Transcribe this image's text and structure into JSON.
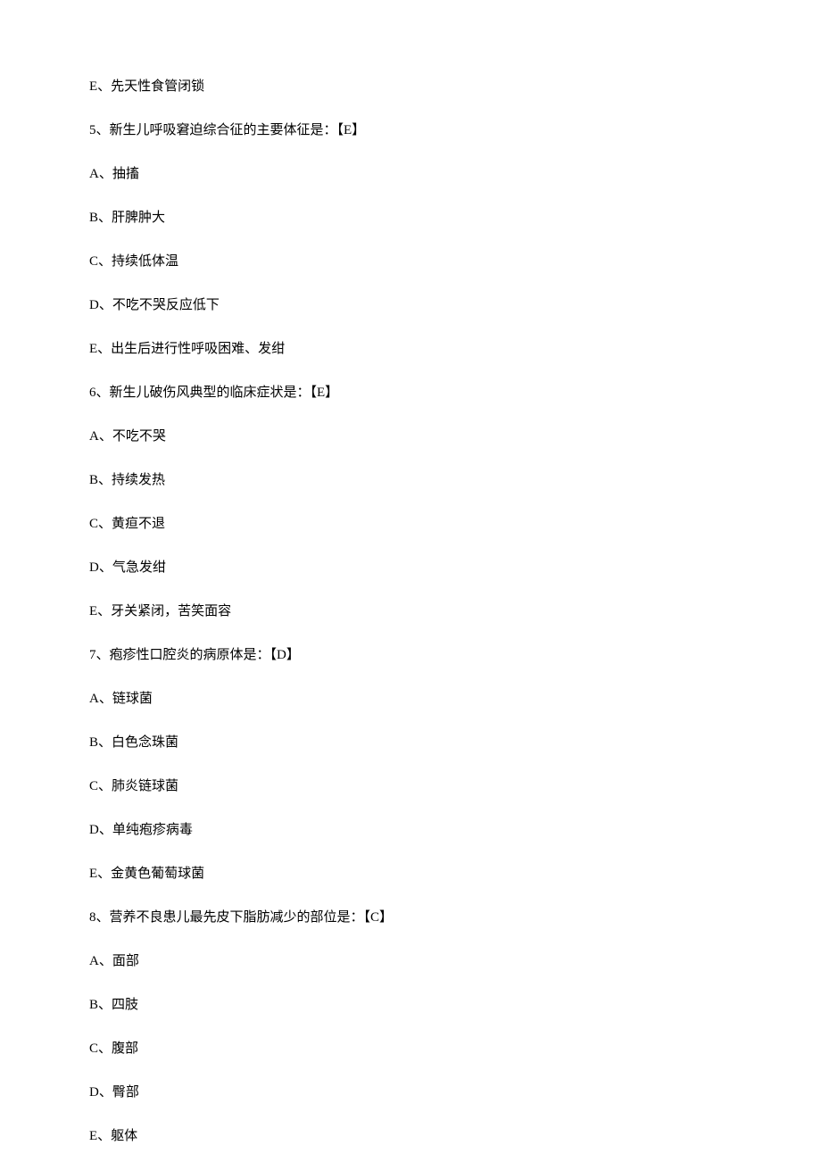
{
  "lines": [
    "E、先天性食管闭锁",
    "5、新生儿呼吸窘迫综合征的主要体征是：【E】",
    "A、抽搐",
    "B、肝脾肿大",
    "C、持续低体温",
    "D、不吃不哭反应低下",
    "E、出生后进行性呼吸困难、发绀",
    "6、新生儿破伤风典型的临床症状是：【E】",
    "A、不吃不哭",
    "B、持续发热",
    "C、黄疸不退",
    "D、气急发绀",
    "E、牙关紧闭，苦笑面容",
    "7、疱疹性口腔炎的病原体是：【D】",
    "A、链球菌",
    "B、白色念珠菌",
    "C、肺炎链球菌",
    "D、单纯疱疹病毒",
    "E、金黄色葡萄球菌",
    "8、营养不良患儿最先皮下脂肪减少的部位是：【C】",
    "A、面部",
    "B、四肢",
    "C、腹部",
    "D、臀部",
    "E、躯体"
  ]
}
